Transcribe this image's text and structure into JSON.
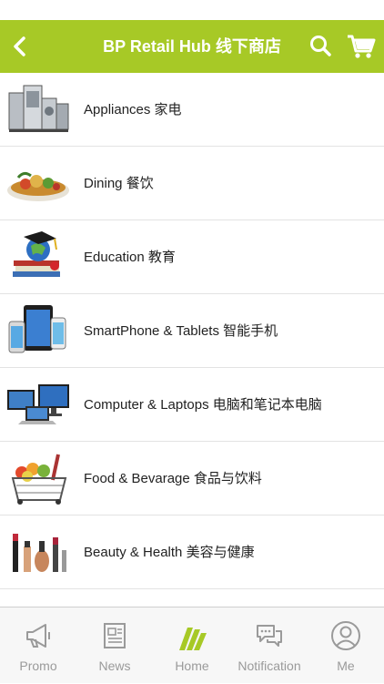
{
  "header": {
    "title": "BP Retail Hub 线下商店",
    "back_icon": "chevron-left-icon",
    "search_icon": "search-icon",
    "cart_icon": "cart-icon",
    "color": "#a7c926"
  },
  "categories": [
    {
      "label": "Appliances 家电",
      "icon": "appliances-image"
    },
    {
      "label": "Dining 餐饮",
      "icon": "dining-image"
    },
    {
      "label": "Education 教育",
      "icon": "education-image"
    },
    {
      "label": "SmartPhone & Tablets 智能手机",
      "icon": "smartphone-tablets-image"
    },
    {
      "label": "Computer & Laptops 电脑和笔记本电脑",
      "icon": "computer-laptops-image"
    },
    {
      "label": "Food & Bevarage 食品与饮料",
      "icon": "food-beverage-image"
    },
    {
      "label": "Beauty & Health 美容与健康",
      "icon": "beauty-health-image"
    }
  ],
  "tabbar": {
    "tabs": [
      {
        "label": "Promo",
        "icon": "megaphone-icon"
      },
      {
        "label": "News",
        "icon": "newspaper-icon"
      },
      {
        "label": "Home",
        "icon": "home-logo-icon",
        "active": true
      },
      {
        "label": "Notification",
        "icon": "chat-bubbles-icon"
      },
      {
        "label": "Me",
        "icon": "user-icon"
      }
    ]
  }
}
